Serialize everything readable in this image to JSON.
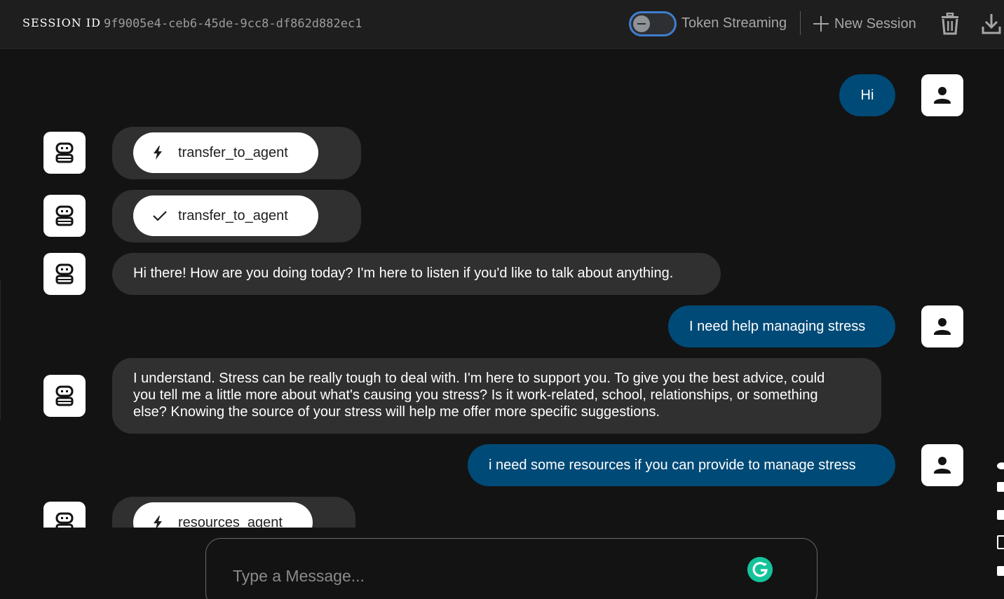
{
  "header": {
    "session_label": "SESSION ID",
    "session_id": "9f9005e4-ceb6-45de-9cc8-df862d882ec1",
    "token_streaming_label": "Token Streaming",
    "token_streaming_on": false,
    "new_session_label": "New Session",
    "icons": [
      "plus-icon",
      "trash-icon",
      "download-icon"
    ]
  },
  "messages": [
    {
      "role": "user",
      "type": "text",
      "text": "Hi"
    },
    {
      "role": "bot",
      "type": "function_call",
      "status": "pending",
      "icon": "bolt-icon",
      "name": "transfer_to_agent"
    },
    {
      "role": "bot",
      "type": "function_response",
      "status": "done",
      "icon": "check-icon",
      "name": "transfer_to_agent"
    },
    {
      "role": "bot",
      "type": "text",
      "text": "Hi there! How are you doing today? I'm here to listen if you'd like to talk about anything."
    },
    {
      "role": "user",
      "type": "text",
      "text": "I need help managing stress"
    },
    {
      "role": "bot",
      "type": "text",
      "lines": [
        "I understand. Stress can be really tough to deal with. I'm here to support you. To give you the best advice, could",
        "you tell me a little more about what's causing you stress? Is it work-related, school, relationships, or something",
        "else? Knowing the source of your stress will help me offer more specific suggestions."
      ]
    },
    {
      "role": "user",
      "type": "text",
      "text": "i need some resources if you can provide to manage stress"
    },
    {
      "role": "bot",
      "type": "function_call",
      "status": "pending",
      "icon": "bolt-icon",
      "name": "resources_agent"
    }
  ],
  "input": {
    "placeholder": "Type a Message...",
    "value": ""
  },
  "colors": {
    "background": "#131313",
    "header_bg": "#1e1e1e",
    "user_bubble": "#004a77",
    "bot_bubble": "#303030",
    "toggle_border": "#3f7ecf"
  }
}
